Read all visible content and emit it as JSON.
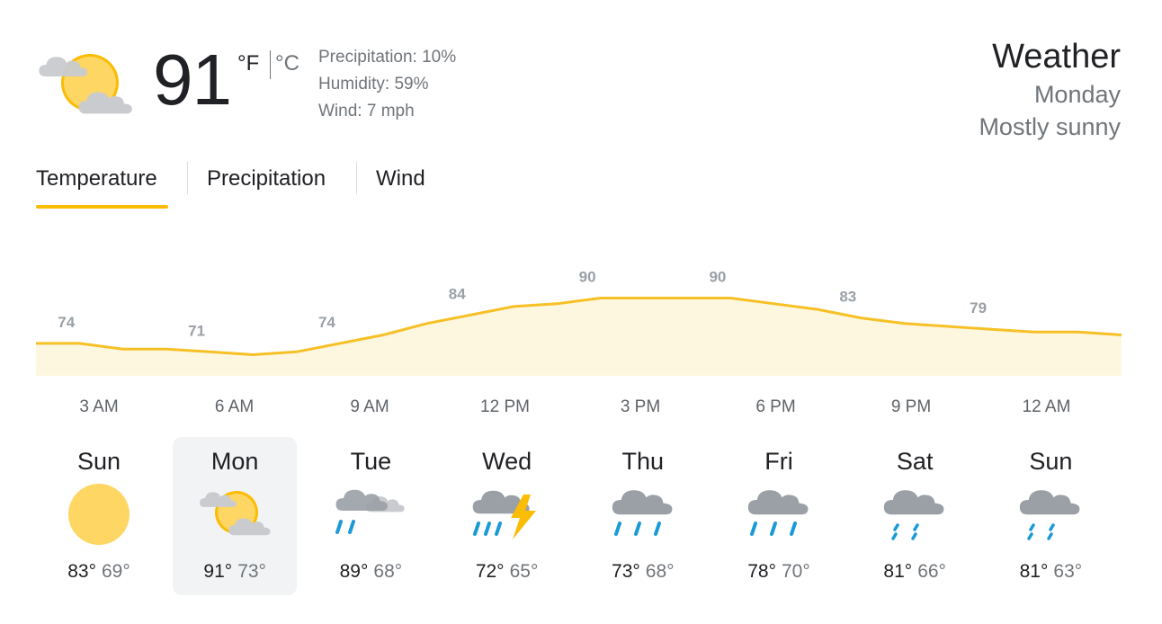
{
  "current": {
    "temperature": "91",
    "unit_f": "°F",
    "unit_c": "°C",
    "precipitation": "Precipitation: 10%",
    "humidity": "Humidity: 59%",
    "wind": "Wind: 7 mph",
    "icon": "partly-cloudy-icon"
  },
  "header": {
    "title": "Weather",
    "day": "Monday",
    "condition": "Mostly sunny"
  },
  "tabs": [
    {
      "label": "Temperature",
      "selected": true
    },
    {
      "label": "Precipitation",
      "selected": false
    },
    {
      "label": "Wind",
      "selected": false
    }
  ],
  "colors": {
    "accent": "#fbbc04",
    "line": "#f6c026",
    "fill": "#fef7e0",
    "rain": "#1a9ad6"
  },
  "chart_data": {
    "type": "area",
    "ylim": [
      60,
      100
    ],
    "values": [
      74,
      74,
      72,
      72,
      71,
      70,
      71,
      74,
      77,
      81,
      84,
      87,
      88,
      90,
      90,
      90,
      90,
      88,
      86,
      83,
      81,
      80,
      79,
      78,
      78,
      77
    ],
    "labels": [
      "74",
      "71",
      "74",
      "84",
      "90",
      "90",
      "83",
      "79"
    ],
    "label_indices": [
      1,
      4,
      7,
      10,
      13,
      16,
      19,
      22
    ],
    "hours": [
      "3 AM",
      "6 AM",
      "9 AM",
      "12 PM",
      "3 PM",
      "6 PM",
      "9 PM",
      "12 AM"
    ]
  },
  "days": [
    {
      "name": "Sun",
      "hi": "83°",
      "lo": "69°",
      "icon": "sunny-icon",
      "selected": false
    },
    {
      "name": "Mon",
      "hi": "91°",
      "lo": "73°",
      "icon": "partly-cloudy-icon",
      "selected": true
    },
    {
      "name": "Tue",
      "hi": "89°",
      "lo": "68°",
      "icon": "showers-icon",
      "selected": false
    },
    {
      "name": "Wed",
      "hi": "72°",
      "lo": "65°",
      "icon": "thunderstorm-icon",
      "selected": false
    },
    {
      "name": "Thu",
      "hi": "73°",
      "lo": "68°",
      "icon": "rain-icon",
      "selected": false
    },
    {
      "name": "Fri",
      "hi": "78°",
      "lo": "70°",
      "icon": "rain-icon",
      "selected": false
    },
    {
      "name": "Sat",
      "hi": "81°",
      "lo": "66°",
      "icon": "scattered-showers-icon",
      "selected": false
    },
    {
      "name": "Sun",
      "hi": "81°",
      "lo": "63°",
      "icon": "scattered-showers-icon",
      "selected": false
    }
  ]
}
